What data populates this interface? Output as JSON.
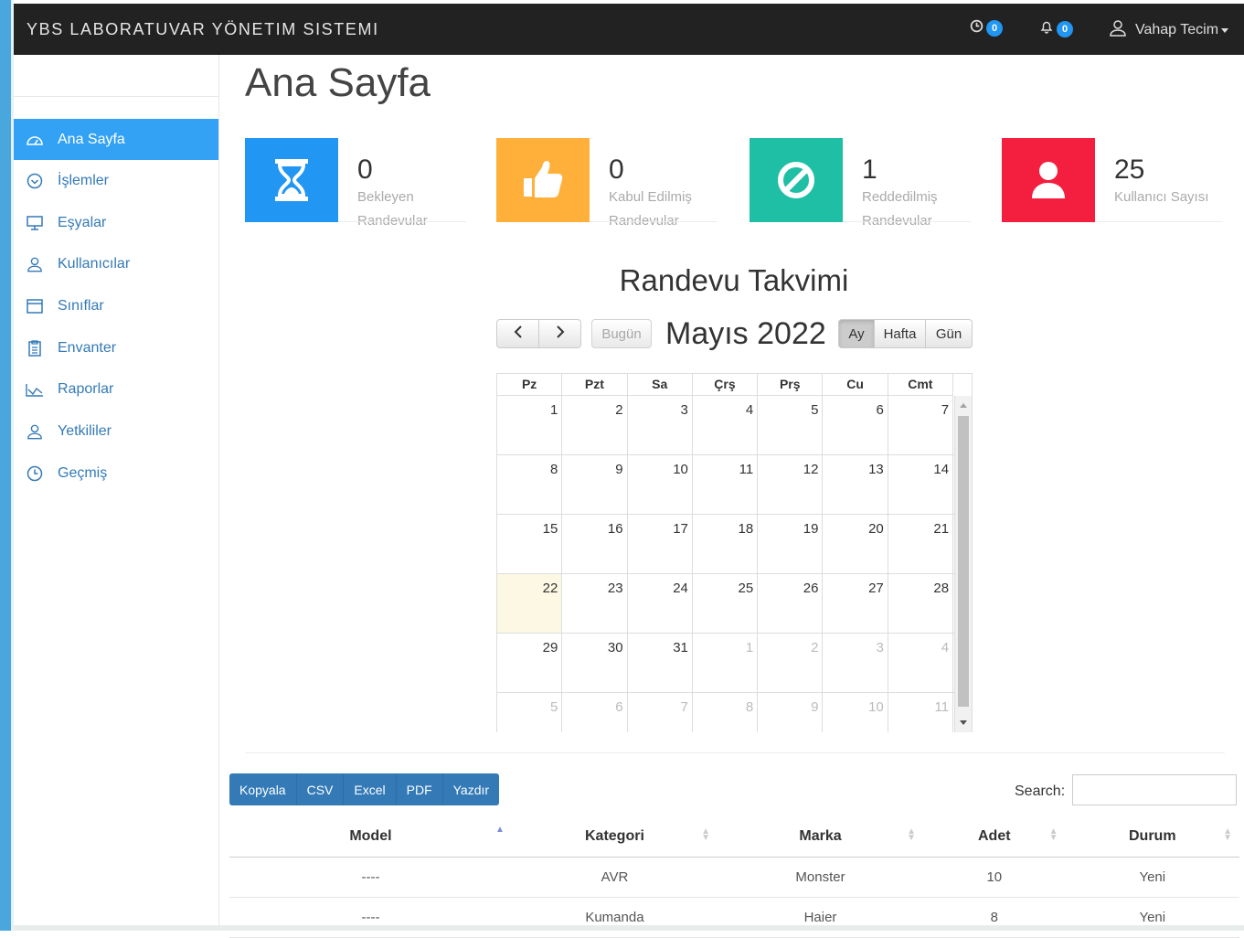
{
  "app": {
    "title": "YBS LABORATUVAR YÖNETIM SISTEMI"
  },
  "topbar": {
    "tasks_count": "0",
    "alerts_count": "0",
    "user_name": "Vahap Tecim"
  },
  "sidebar": {
    "items": [
      {
        "label": "Ana Sayfa",
        "icon": "dashboard-icon",
        "active": true
      },
      {
        "label": "İşlemler",
        "icon": "check-circle-icon"
      },
      {
        "label": "Eşyalar",
        "icon": "monitor-icon"
      },
      {
        "label": "Kullanıcılar",
        "icon": "user-icon"
      },
      {
        "label": "Sınıflar",
        "icon": "window-icon"
      },
      {
        "label": "Envanter",
        "icon": "clipboard-icon"
      },
      {
        "label": "Raporlar",
        "icon": "chart-line-icon"
      },
      {
        "label": "Yetkililer",
        "icon": "user-icon"
      },
      {
        "label": "Geçmiş",
        "icon": "clock-icon"
      }
    ]
  },
  "page": {
    "title": "Ana Sayfa"
  },
  "stats": [
    {
      "value": "0",
      "label": "Bekleyen Randevular",
      "color": "#2196f3",
      "icon": "hourglass-icon"
    },
    {
      "value": "0",
      "label": "Kabul Edilmiş Randevular",
      "color": "#ffb03b",
      "icon": "thumbs-up-icon"
    },
    {
      "value": "1",
      "label": "Reddedilmiş Randevular",
      "color": "#1fbfa5",
      "icon": "ban-icon"
    },
    {
      "value": "25",
      "label": "Kullanıcı Sayısı",
      "color": "#f41f3e",
      "icon": "user-icon"
    }
  ],
  "calendar": {
    "title": "Randevu Takvimi",
    "month": "Mayıs 2022",
    "today_label": "Bugün",
    "views": [
      "Ay",
      "Hafta",
      "Gün"
    ],
    "active_view": "Ay",
    "weekdays": [
      "Pz",
      "Pzt",
      "Sa",
      "Çrş",
      "Prş",
      "Cu",
      "Cmt"
    ],
    "weeks": [
      [
        "1",
        "2",
        "3",
        "4",
        "5",
        "6",
        "7"
      ],
      [
        "8",
        "9",
        "10",
        "11",
        "12",
        "13",
        "14"
      ],
      [
        "15",
        "16",
        "17",
        "18",
        "19",
        "20",
        "21"
      ],
      [
        "22",
        "23",
        "24",
        "25",
        "26",
        "27",
        "28"
      ],
      [
        "29",
        "30",
        "31",
        "1",
        "2",
        "3",
        "4"
      ],
      [
        "5",
        "6",
        "7",
        "8",
        "9",
        "10",
        "11"
      ]
    ],
    "today": "22"
  },
  "table_tools": {
    "buttons": [
      "Kopyala",
      "CSV",
      "Excel",
      "PDF",
      "Yazdır"
    ],
    "search_label": "Search:"
  },
  "table": {
    "columns": [
      "Model",
      "Kategori",
      "Marka",
      "Adet",
      "Durum"
    ],
    "rows": [
      [
        "----",
        "AVR",
        "Monster",
        "10",
        "Yeni"
      ],
      [
        "----",
        "Kumanda",
        "Haier",
        "8",
        "Yeni"
      ]
    ]
  }
}
